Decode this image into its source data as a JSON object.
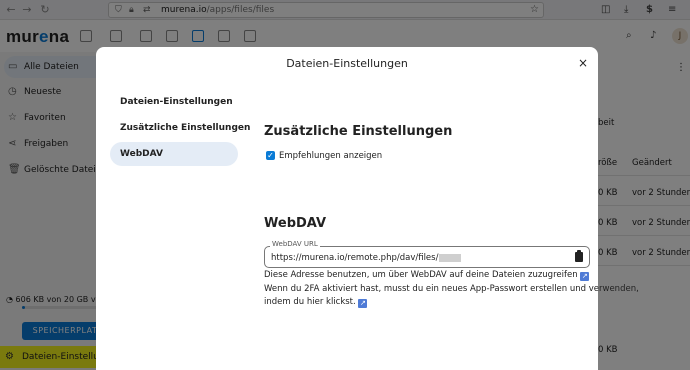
{
  "browser": {
    "url_host": "murena.io",
    "url_path": "/apps/files/files",
    "dollar_icon": "$"
  },
  "header": {
    "logo_text": "mur",
    "logo_o": "e",
    "logo_suffix": "na",
    "avatar_initial": "J"
  },
  "sidebar": {
    "items": [
      {
        "label": "Alle Dateien",
        "icon": "folder-icon"
      },
      {
        "label": "Neueste",
        "icon": "clock-icon"
      },
      {
        "label": "Favoriten",
        "icon": "star-icon"
      },
      {
        "label": "Freigaben",
        "icon": "share-icon"
      },
      {
        "label": "Gelöschte Dateien",
        "icon": "trash-icon"
      }
    ],
    "quota_text": "606 KB von 20 GB ve",
    "quota_fraction": 0.03,
    "storage_button": "SPEICHERPLATZ",
    "settings_label": "Dateien-Einstellungen"
  },
  "background": {
    "search_partial": "beit",
    "col_size_partial": "röße",
    "col_changed": "Geändert",
    "rows": [
      {
        "size": "0 KB",
        "changed": "vor 2 Stunden"
      },
      {
        "size": "0 KB",
        "changed": "vor 2 Stunden"
      },
      {
        "size": "0 KB",
        "changed": "vor 2 Stunden"
      },
      {
        "size": "0 KB",
        "changed": ""
      }
    ]
  },
  "modal": {
    "title": "Dateien-Einstellungen",
    "close": "×",
    "nav": [
      {
        "label": "Dateien-Einstellungen"
      },
      {
        "label": "Zusätzliche Einstellungen"
      },
      {
        "label": "WebDAV"
      }
    ],
    "additional_title": "Zusätzliche Einstellungen",
    "checkbox_label": "Empfehlungen anzeigen",
    "checkbox_checked": true,
    "webdav_title": "WebDAV",
    "webdav_field_label": "WebDAV URL",
    "webdav_url": "https://murena.io/remote.php/dav/files/",
    "help_line1": "Diese Adresse benutzen, um über WebDAV auf deine Dateien zuzugreifen",
    "help_line2": "Wenn du 2FA aktiviert hast, musst du ein neues App-Passwort erstellen und verwenden,",
    "help_line3": "indem du hier klickst.",
    "ext_icon": "↗"
  }
}
